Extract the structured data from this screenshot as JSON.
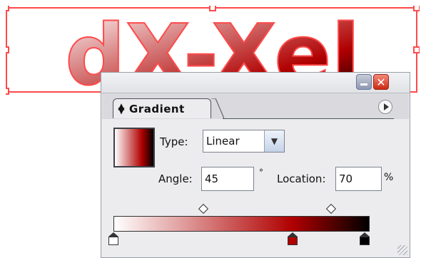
{
  "artwork": {
    "text": "dX-Xel"
  },
  "panel": {
    "tab_label": "Gradient",
    "type_label": "Type:",
    "type_value": "Linear",
    "angle_label": "Angle:",
    "angle_value": "45",
    "angle_unit": "°",
    "location_label": "Location:",
    "location_value": "70",
    "location_unit": "%",
    "stops": [
      {
        "position": 0,
        "color": "#ffffff"
      },
      {
        "position": 70,
        "color": "#b00000"
      },
      {
        "position": 100,
        "color": "#000000"
      }
    ],
    "midpoints": [
      35,
      85
    ]
  },
  "icons": {
    "minimize": "minimize-icon",
    "close": "close-icon",
    "menu": "panel-menu-icon",
    "tab_toggle": "collapse-toggle-icon",
    "dropdown": "chevron-down-icon"
  }
}
